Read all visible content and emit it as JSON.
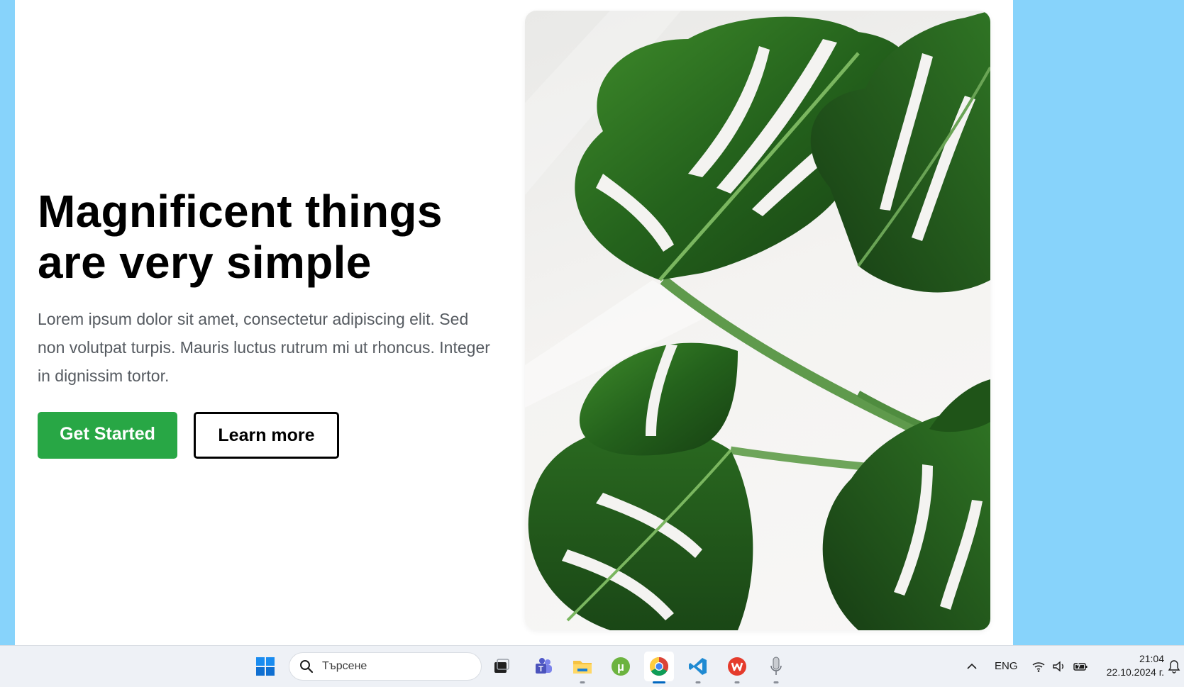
{
  "hero": {
    "title_line1": "Magnificent things",
    "title_line2": "are very simple",
    "description": "Lorem ipsum dolor sit amet, consectetur adipiscing elit. Sed non volutpat turpis. Mauris luctus rutrum mi ut rhoncus. Integer in dignissim tortor.",
    "primary_button": "Get Started",
    "secondary_button": "Learn more",
    "image_subject": "monstera-leaves"
  },
  "colors": {
    "background": "#87d3fb",
    "primary_button": "#28a745",
    "text": "#000000",
    "muted_text": "#555a60"
  },
  "taskbar": {
    "search_placeholder": "Търсене",
    "apps": [
      "start-icon",
      "task-view-icon",
      "teams-icon",
      "file-explorer-icon",
      "utorrent-icon",
      "chrome-icon",
      "vscode-icon",
      "wps-icon",
      "microphone-icon"
    ],
    "active_app": "chrome-icon",
    "language": "ENG",
    "time": "21:04",
    "date": "22.10.2024 г."
  }
}
